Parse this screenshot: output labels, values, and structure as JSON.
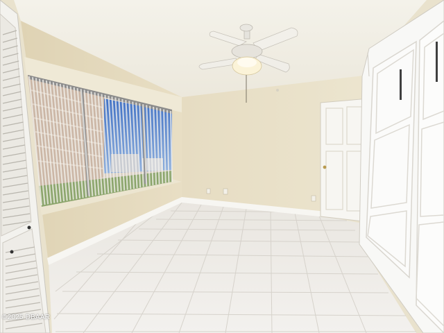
{
  "photo": {
    "watermark": "©2025 DBAAR",
    "colors": {
      "ceiling": "#f1efe6",
      "wall": "#e8e0c8",
      "wall_shade": "#ddd3b8",
      "floor_tile": "#eeeae4",
      "trim": "#f6f5f1",
      "sky": "#4f7fc8",
      "building": "#cdb9a8"
    }
  }
}
